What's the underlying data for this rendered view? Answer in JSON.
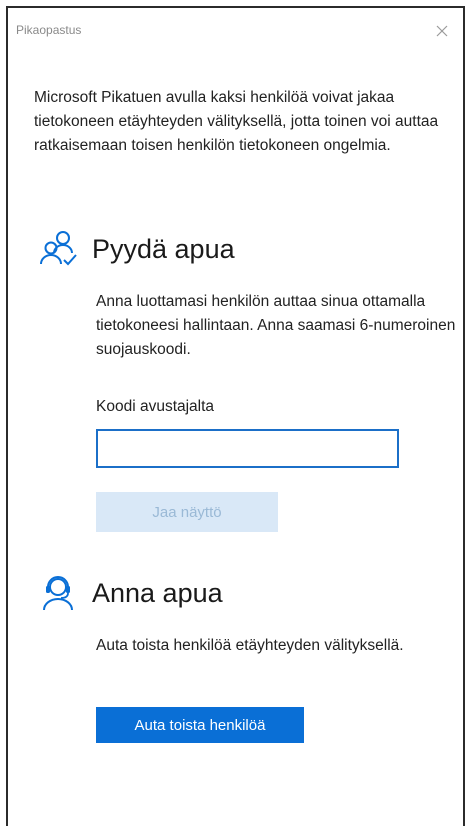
{
  "window": {
    "title": "Pikaopastus"
  },
  "intro_text": "Microsoft Pikatuen avulla kaksi henkilöä voivat jakaa tietokoneen etäyhteyden välityksellä, jotta toinen voi auttaa ratkaisemaan toisen henkilön tietokoneen ongelmia.",
  "get_help": {
    "icon": "people-request-icon",
    "title": "Pyydä apua",
    "description": "Anna luottamasi henkilön auttaa sinua ottamalla tietokoneesi hallintaan. Anna saamasi 6-numeroinen suojauskoodi.",
    "code_label": "Koodi avustajalta",
    "code_value": "",
    "share_button_label": "Jaa näyttö",
    "share_button_enabled": false
  },
  "give_help": {
    "icon": "support-person-headset-icon",
    "title": "Anna apua",
    "description": "Auta toista henkilöä etäyhteyden välityksellä.",
    "help_button_label": "Auta toista henkilöä"
  },
  "colors": {
    "accent": "#0a6fd6",
    "disabled_button_bg": "#d9e8f7",
    "disabled_button_text": "#9ab9d6"
  }
}
